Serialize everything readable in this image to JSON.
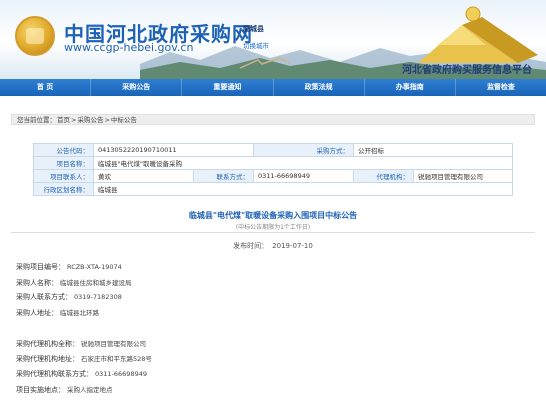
{
  "header": {
    "site_title": "中国河北政府采购网",
    "site_url": "www.ccgp-hebei.gov.cn",
    "city": "临城县",
    "switch_city": "切换城市",
    "slogan": "河北省政府购买服务信息平台"
  },
  "nav": {
    "items": [
      "首  页",
      "采购公告",
      "重要通知",
      "政策法规",
      "办事指南",
      "监督检查"
    ]
  },
  "breadcrumb": {
    "prefix": "您当前位置：",
    "items": [
      "首页",
      "采购公告",
      "中标公告"
    ],
    "separator": ">"
  },
  "info": {
    "notice_code_label": "公告代码：",
    "notice_code": "0413052220190710011",
    "purchase_method_label": "采购方式：",
    "purchase_method": "公开招标",
    "project_name_label": "项目名称：",
    "project_name": "临城县\"电代煤\"取暖设备采购",
    "contact_label": "项目联系人：",
    "contact": "黄欢",
    "phone_label": "联系方式：",
    "phone": "0311-66698949",
    "agency_label": "代理机构：",
    "agency": "锐驰项目管理有限公司",
    "region_label": "行政区划名称：",
    "region": "临城县"
  },
  "article": {
    "title": "临城县\"电代煤\"取暖设备采购入围项目中标公告",
    "subtitle": "(中标公告期限为1个工作日)",
    "pub_label": "发布时间：",
    "pub_date": "2019-07-10",
    "lines": [
      {
        "k": "采购项目编号：",
        "v": "RCZB-XTA-19074"
      },
      {
        "k": "采购人名称：",
        "v": "临城县住房和城乡建设局"
      },
      {
        "k": "采购人联系方式：",
        "v": "0319-7182308"
      },
      {
        "k": "采购人地址：",
        "v": "临城县北环路"
      },
      {
        "k": "采购代理机构全称：",
        "v": "锐驰项目管理有限公司"
      },
      {
        "k": "采购代理机构地址：",
        "v": "石家庄市和平东路528号"
      },
      {
        "k": "采购代理机构联系方式：",
        "v": "0311-66698949"
      },
      {
        "k": "项目实施地点：",
        "v": "采购人指定地点"
      }
    ]
  },
  "colors": {
    "brand_blue": "#1d62b4",
    "nav_blue": "#1864b8",
    "label_bg": "#e8f1fa"
  }
}
